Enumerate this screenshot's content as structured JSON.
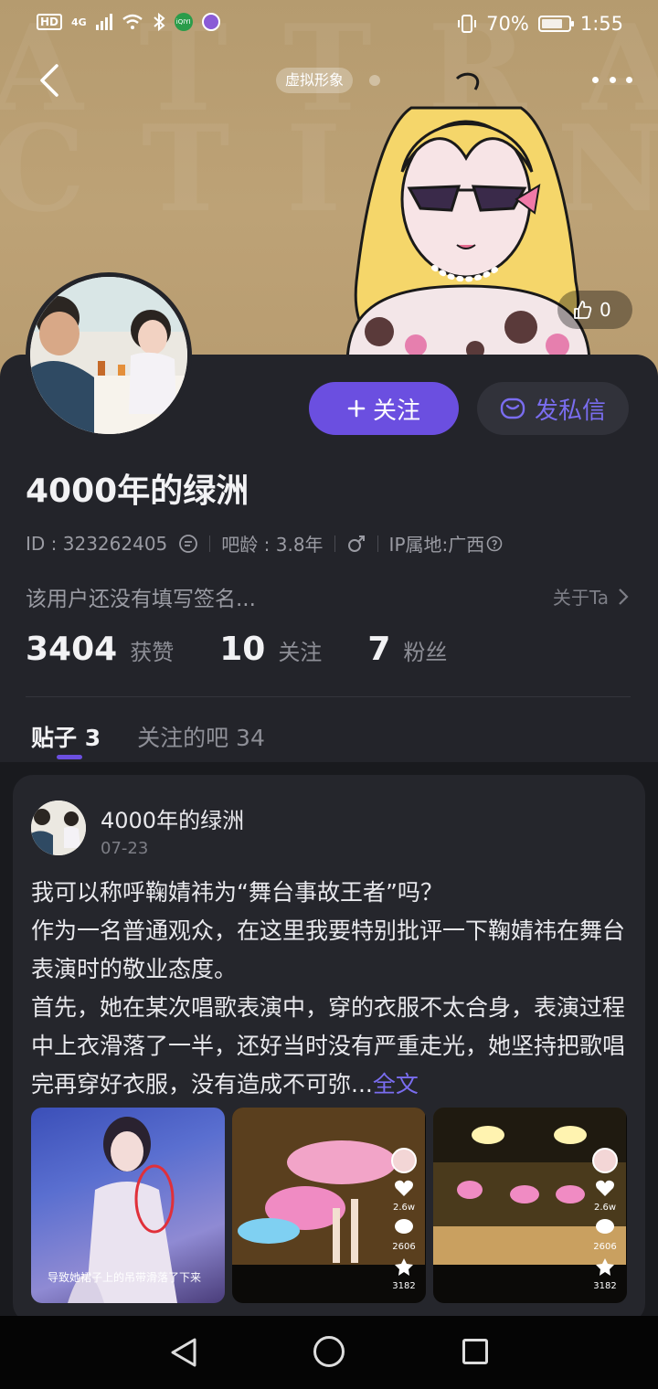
{
  "statusbar": {
    "battery": "70%",
    "time": "1:55",
    "network": "4G",
    "hd": "HD",
    "app_icon_text": "iQIYI",
    "app_icon2_text": "贴"
  },
  "header": {
    "avatar_chip": "虚拟形象",
    "like_count": "0"
  },
  "profile": {
    "username": "4000年的绿洲",
    "id_label": "ID : 323262405",
    "age_label": "吧龄 : 3.8年",
    "ip_label": "IP属地:广西",
    "signature": "该用户还没有填写签名...",
    "about_link": "关于Ta",
    "follow_button": "关注",
    "message_button": "发私信",
    "stats": [
      {
        "value": "3404",
        "label": "获赞"
      },
      {
        "value": "10",
        "label": "关注"
      },
      {
        "value": "7",
        "label": "粉丝"
      }
    ]
  },
  "tabs": [
    {
      "label": "贴子 3",
      "active": true
    },
    {
      "label": "关注的吧 34",
      "active": false
    }
  ],
  "post": {
    "author": "4000年的绿洲",
    "date": "07-23",
    "lines": [
      "我可以称呼鞠婧祎为“舞台事故王者”吗？",
      "作为一名普通观众，在这里我要特别批评一下鞠婧祎在舞台表演时的敬业态度。",
      "首先，她在某次唱歌表演中，穿的衣服不太合身，表演过程中上衣滑落了一半，还好当时没有严重走光，她坚持把歌唱完再穿好衣服，没有造成不可弥..."
    ],
    "more_link": "全文",
    "images": [
      {
        "caption": "导致她裙子上的吊带滑落了下来"
      },
      {
        "likes": "2.6w",
        "comments": "2606",
        "favorites": "3182"
      },
      {
        "likes": "2.6w",
        "comments": "2606",
        "favorites": "3182"
      }
    ]
  },
  "colors": {
    "accent": "#6b4fe0",
    "card": "#23242a",
    "banner": "#bda276"
  }
}
